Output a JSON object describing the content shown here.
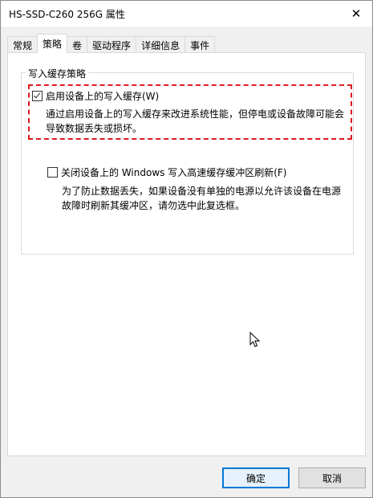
{
  "window": {
    "title": "HS-SSD-C260 256G 属性",
    "close_glyph": "✕"
  },
  "tabs": [
    {
      "label": "常规",
      "active": false
    },
    {
      "label": "策略",
      "active": true
    },
    {
      "label": "卷",
      "active": false
    },
    {
      "label": "驱动程序",
      "active": false
    },
    {
      "label": "详细信息",
      "active": false
    },
    {
      "label": "事件",
      "active": false
    }
  ],
  "policy": {
    "group_title": "写入缓存策略",
    "write_cache": {
      "label": "启用设备上的写入缓存(W)",
      "checked": true,
      "desc_line1": "通过启用设备上的写入缓存来改进系统性能，但停电或设备故障可能会",
      "desc_line2": "导致数据丢失或损坏。"
    },
    "flush": {
      "label": "关闭设备上的 Windows 写入高速缓存缓冲区刷新(F)",
      "checked": false,
      "desc_line1": "为了防止数据丢失，如果设备没有单独的电源以允许该设备在电源",
      "desc_line2": "故障时刷新其缓冲区，请勿选中此复选框。"
    },
    "highlight_color": "#e0191f"
  },
  "buttons": {
    "ok": "确定",
    "cancel": "取消"
  },
  "icons": {
    "close": "close-icon",
    "check": "checkmark-icon",
    "pointer": "mouse-pointer-icon"
  }
}
